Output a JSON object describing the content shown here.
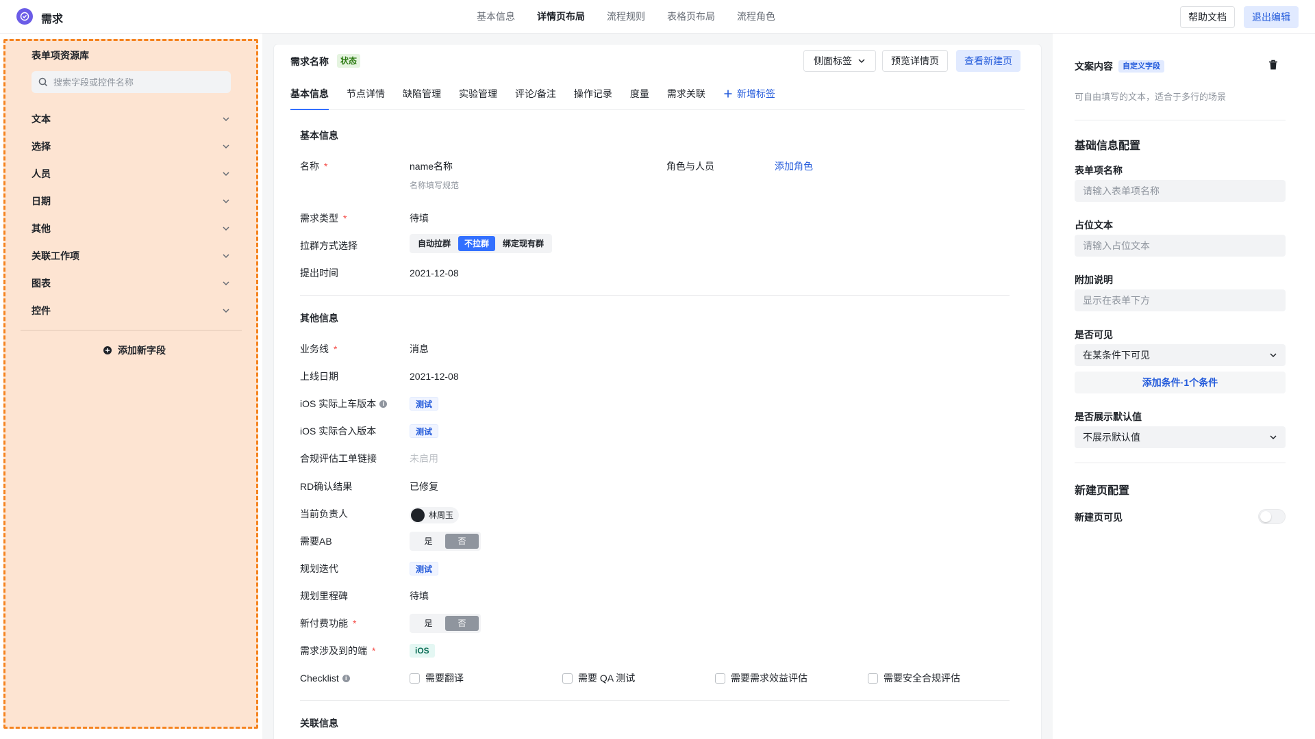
{
  "app": {
    "title": "需求"
  },
  "top_nav": [
    {
      "label": "基本信息",
      "active": false
    },
    {
      "label": "详情页布局",
      "active": true
    },
    {
      "label": "流程规则",
      "active": false
    },
    {
      "label": "表格页布局",
      "active": false
    },
    {
      "label": "流程角色",
      "active": false
    }
  ],
  "header_buttons": {
    "help": "帮助文档",
    "exit": "退出编辑"
  },
  "library": {
    "title": "表单项资源库",
    "search_placeholder": "搜索字段或控件名称",
    "categories": [
      "文本",
      "选择",
      "人员",
      "日期",
      "其他",
      "关联工作项",
      "图表",
      "控件"
    ],
    "add_field": "添加新字段"
  },
  "detail": {
    "title": "需求名称",
    "status": "状态",
    "buttons": {
      "side_tab": "侧面标签",
      "preview": "预览详情页",
      "view_new": "查看新建页"
    },
    "tabs": [
      "基本信息",
      "节点详情",
      "缺陷管理",
      "实验管理",
      "评论/备注",
      "操作记录",
      "度量",
      "需求关联"
    ],
    "add_tab": "新增标签",
    "basic": {
      "title": "基本信息",
      "name_label": "名称",
      "name_value": "name名称",
      "name_hint": "名称填写规范",
      "roles_label": "角色与人员",
      "roles_action": "添加角色",
      "type_label": "需求类型",
      "type_value": "待填",
      "group_label": "拉群方式选择",
      "group_options": [
        "自动拉群",
        "不拉群",
        "绑定现有群"
      ],
      "submit_label": "提出时间",
      "submit_value": "2021-12-08"
    },
    "other": {
      "title": "其他信息",
      "business_label": "业务线",
      "business_value": "消息",
      "online_label": "上线日期",
      "online_value": "2021-12-08",
      "ios_real_label": "iOS 实际上车版本",
      "ios_real_value": "测试",
      "ios_merge_label": "iOS 实际合入版本",
      "ios_merge_value": "测试",
      "compliance_label": "合规评估工单链接",
      "compliance_value": "未启用",
      "rd_label": "RD确认结果",
      "rd_value": "已修复",
      "owner_label": "当前负责人",
      "owner_value": "林周玉",
      "ab_label": "需要AB",
      "yes": "是",
      "no": "否",
      "iter_label": "规划迭代",
      "iter_value": "测试",
      "milestone_label": "规划里程碑",
      "milestone_value": "待填",
      "paid_label": "新付费功能",
      "platform_label": "需求涉及到的端",
      "platform_value": "iOS",
      "checklist_label": "Checklist",
      "checklist_items": [
        "需要翻译",
        "需要 QA 测试",
        "需要需求效益评估",
        "需要安全合规评估"
      ]
    },
    "related": {
      "title": "关联信息"
    }
  },
  "props": {
    "field_title": "文案内容",
    "field_tag": "自定义字段",
    "field_desc": "可自由填写的文本，适合于多行的场景",
    "basic_config": "基础信息配置",
    "name_label": "表单项名称",
    "name_placeholder": "请输入表单项名称",
    "placeholder_label": "占位文本",
    "placeholder_placeholder": "请输入占位文本",
    "extra_label": "附加说明",
    "extra_placeholder": "显示在表单下方",
    "visible_label": "是否可见",
    "visible_value": "在某条件下可见",
    "add_condition": "添加条件·1个条件",
    "default_label": "是否展示默认值",
    "default_value": "不展示默认值",
    "newpage_config": "新建页配置",
    "newpage_visible": "新建页可见",
    "newpage_visible_on": false
  },
  "colors": {
    "accent": "#3370ff",
    "link": "#245bdb",
    "dashed": "#f5831f",
    "dashed_fill": "#fde4d2",
    "required": "#f54a45"
  }
}
